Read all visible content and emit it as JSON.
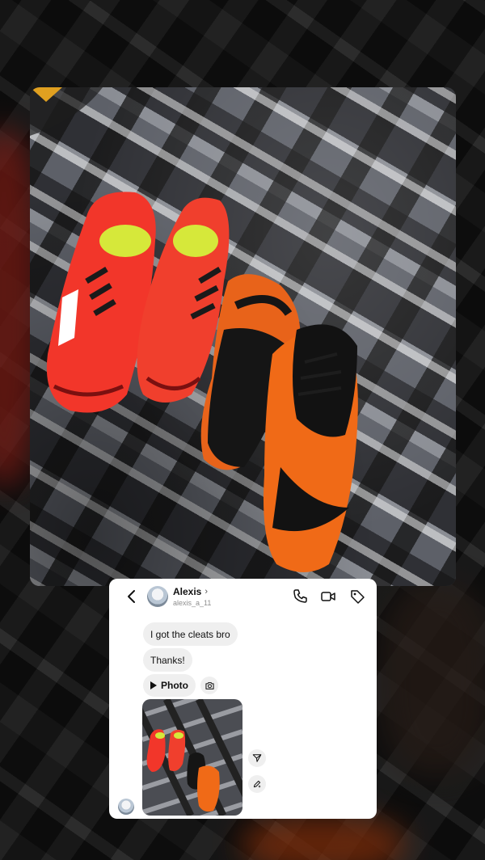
{
  "contact": {
    "name": "Alexis",
    "chevron": "›",
    "handle": "alexis_a_11"
  },
  "header_icons": [
    "back-chevron-icon",
    "phone-icon",
    "video-camera-icon",
    "tag-icon"
  ],
  "messages": [
    {
      "text": "I got the cleats bro"
    },
    {
      "text": "Thanks!"
    }
  ],
  "media_label": "Photo",
  "colors": {
    "card_bg": "#ffffff",
    "bubble_bg": "#efefef",
    "text": "#111111",
    "muted": "#8e8e8e"
  }
}
